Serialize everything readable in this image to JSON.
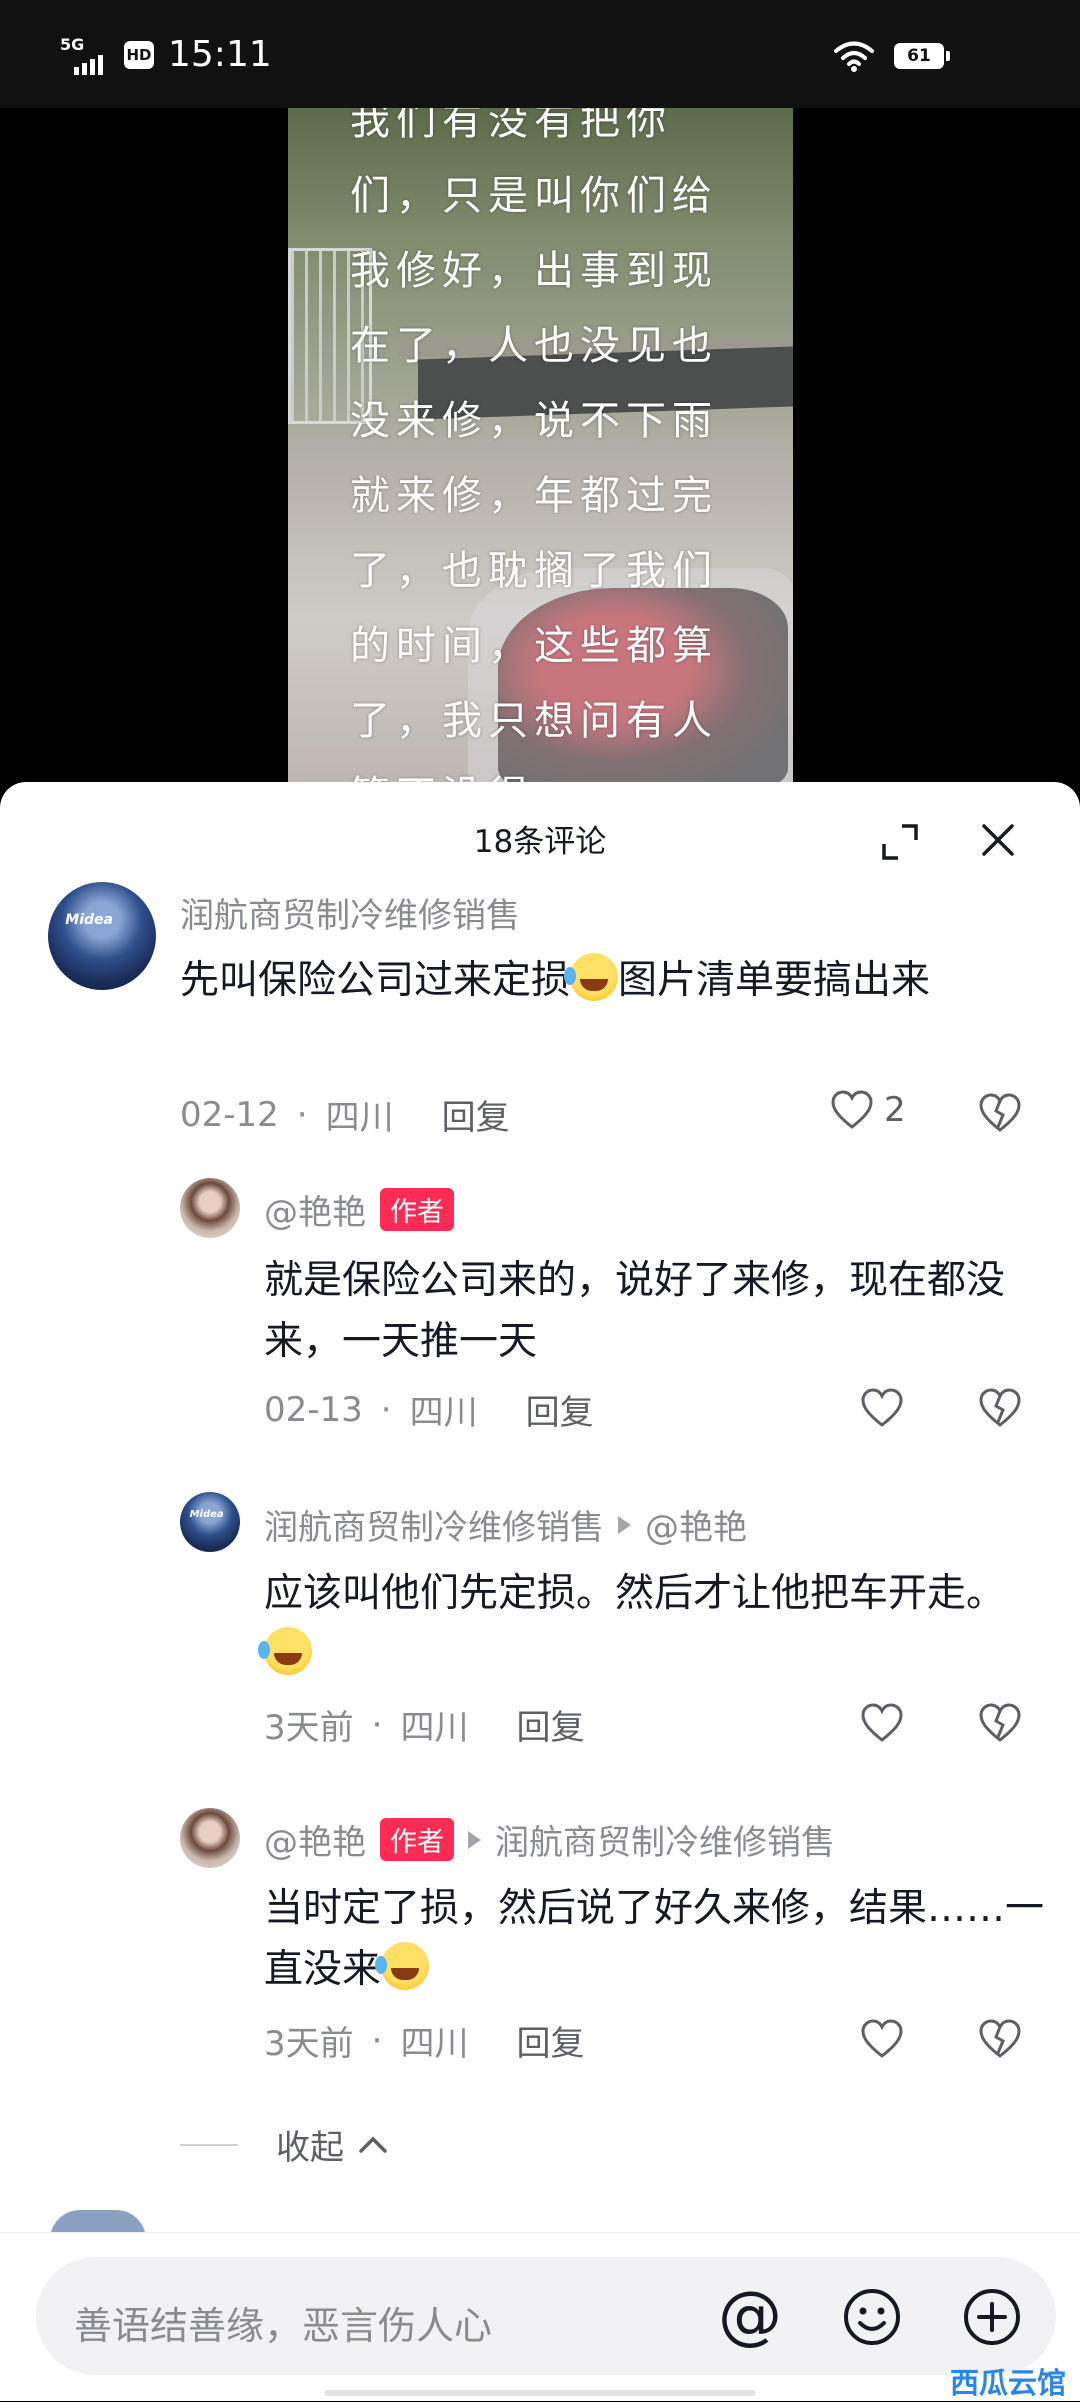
{
  "status_bar": {
    "network": "5G",
    "hd": "HD",
    "time": "15:11",
    "battery": "61"
  },
  "video": {
    "overlay_text": "我们有没有把你\n们，只是叫你们给\n我修好，出事到现\n在了，人也没见也\n没来修，说不下雨\n就来修，年都过完\n了，也耽搁了我们\n的时间，这些都算\n了，我只想问有人\n管不没得"
  },
  "sheet": {
    "title": "18条评论"
  },
  "comments": [
    {
      "user": "润航商贸制冷维修销售",
      "avatar_text": "Midea",
      "text": "先叫保险公司过来定损",
      "text_after_emoji": "图片清单要搞出来",
      "date": "02-12",
      "dot": "·",
      "location": "四川",
      "reply_label": "回复",
      "likes": "2"
    }
  ],
  "replies": [
    {
      "user": "@艳艳",
      "badge": "作者",
      "text": "就是保险公司来的，说好了来修，现在都没来，一天推一天",
      "date": "02-13",
      "dot": "·",
      "location": "四川",
      "reply_label": "回复"
    },
    {
      "user": "润航商贸制冷维修销售",
      "reply_to": "@艳艳",
      "avatar_text": "Midea",
      "text": "应该叫他们先定损。然后才让他把车开走。",
      "date": "3天前",
      "dot": "·",
      "location": "四川",
      "reply_label": "回复"
    },
    {
      "user": "@艳艳",
      "badge": "作者",
      "reply_to": "润航商贸制冷维修销售",
      "text": "当时定了损，然后说了好久来修，结果……一直没来",
      "date": "3天前",
      "dot": "·",
      "location": "四川",
      "reply_label": "回复"
    }
  ],
  "collapse_label": "收起",
  "input": {
    "placeholder": "善语结善缘，恶言伤人心",
    "at": "@"
  },
  "watermark": "西瓜云馆",
  "icons": {
    "expand": "expand-icon",
    "close": "close-icon",
    "like": "heart-outline-icon",
    "dislike": "broken-heart-icon",
    "emoji": "smile-icon",
    "add": "plus-circle-icon"
  },
  "colors": {
    "author_badge": "#fe2c55",
    "meta_text": "#8a8b91",
    "body_text": "#161823"
  }
}
